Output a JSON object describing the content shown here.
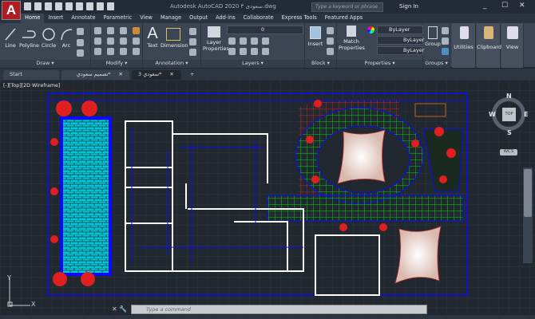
{
  "titlebar": {
    "app_title": "Autodesk AutoCAD 2020   سعودی ۳.dwg",
    "logo": "A",
    "search_placeholder": "Type a keyword or phrase",
    "sign_in": "Sign In",
    "minimize": "_",
    "maximize": "☐",
    "close": "✕"
  },
  "ribbon_tabs": [
    "Home",
    "Insert",
    "Annotate",
    "Parametric",
    "View",
    "Manage",
    "Output",
    "Add-ins",
    "Collaborate",
    "Express Tools",
    "Featured Apps"
  ],
  "active_tab": "Home",
  "panels": {
    "draw": {
      "title": "Draw ▾",
      "buttons": [
        "Line",
        "Polyline",
        "Circle",
        "Arc"
      ]
    },
    "modify": {
      "title": "Modify ▾"
    },
    "annotation": {
      "title": "Annotation ▾",
      "buttons": [
        "Text",
        "Dimension"
      ]
    },
    "layers": {
      "title": "Layers ▾",
      "buttons": [
        "Layer Properties"
      ],
      "layer_value": "0"
    },
    "block": {
      "title": "Block ▾",
      "buttons": [
        "Insert"
      ]
    },
    "properties": {
      "title": "Properties ▾",
      "buttons": [
        "Match Properties"
      ],
      "color": "ByLayer",
      "linetype": "ByLayer",
      "lineweight": "ByLayer"
    },
    "groups": {
      "title": "Groups ▾",
      "buttons": [
        "Group"
      ]
    },
    "utilities": "Utilities",
    "clipboard": "Clipboard",
    "view": "View"
  },
  "file_tabs": [
    {
      "label": "Start"
    },
    {
      "label": "تصميم سعودي*",
      "close": "✕"
    },
    {
      "label": "سعودي 3*",
      "close": "✕",
      "active": true
    }
  ],
  "new_tab": "+",
  "viewport": {
    "label": "[-][Top][2D Wireframe]",
    "viewcube": {
      "top": "TOP",
      "n": "N",
      "s": "S",
      "e": "E",
      "w": "W"
    },
    "wcs": "WCS",
    "ucs_x": "X",
    "ucs_y": "Y"
  },
  "command": {
    "placeholder": "Type a command"
  },
  "colors": {
    "background": "#212830",
    "boundary": "#0000ff",
    "walls": "#ffffff",
    "grid_green": "#00e000",
    "grid_red": "#e02020",
    "pool": "#00e0e0"
  }
}
